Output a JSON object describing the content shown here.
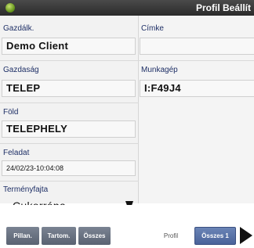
{
  "window": {
    "title": "Profil Beállít"
  },
  "left": {
    "company_label": "Gazdálk.",
    "company_value": "Demo Client",
    "farm_label": "Gazdaság",
    "farm_value": "TELEP",
    "field_label": "Föld",
    "field_value": "TELEPHELY",
    "task_label": "Feladat",
    "task_value": "24/02/23-10:04:08",
    "crop_label": "Terményfajta",
    "crop_value": "Cukorrépa"
  },
  "right": {
    "tag_label": "Címke",
    "tag_value": "",
    "machine_label": "Munkagép",
    "machine_value": "I:F49J4"
  },
  "tabs": [
    {
      "label": "Pillan."
    },
    {
      "label": "Tartom."
    },
    {
      "label": "Összes"
    },
    {
      "label": "Profil"
    },
    {
      "label": "Összes 1"
    }
  ],
  "colors": {
    "label_text": "#1e2f66",
    "tab_dark": "#5a6272",
    "tab_blue": "#4a639a"
  },
  "icons": {
    "app": "app-logo-icon",
    "next": "play-arrow-icon",
    "dropdown": "dropdown-arrow-icon"
  }
}
